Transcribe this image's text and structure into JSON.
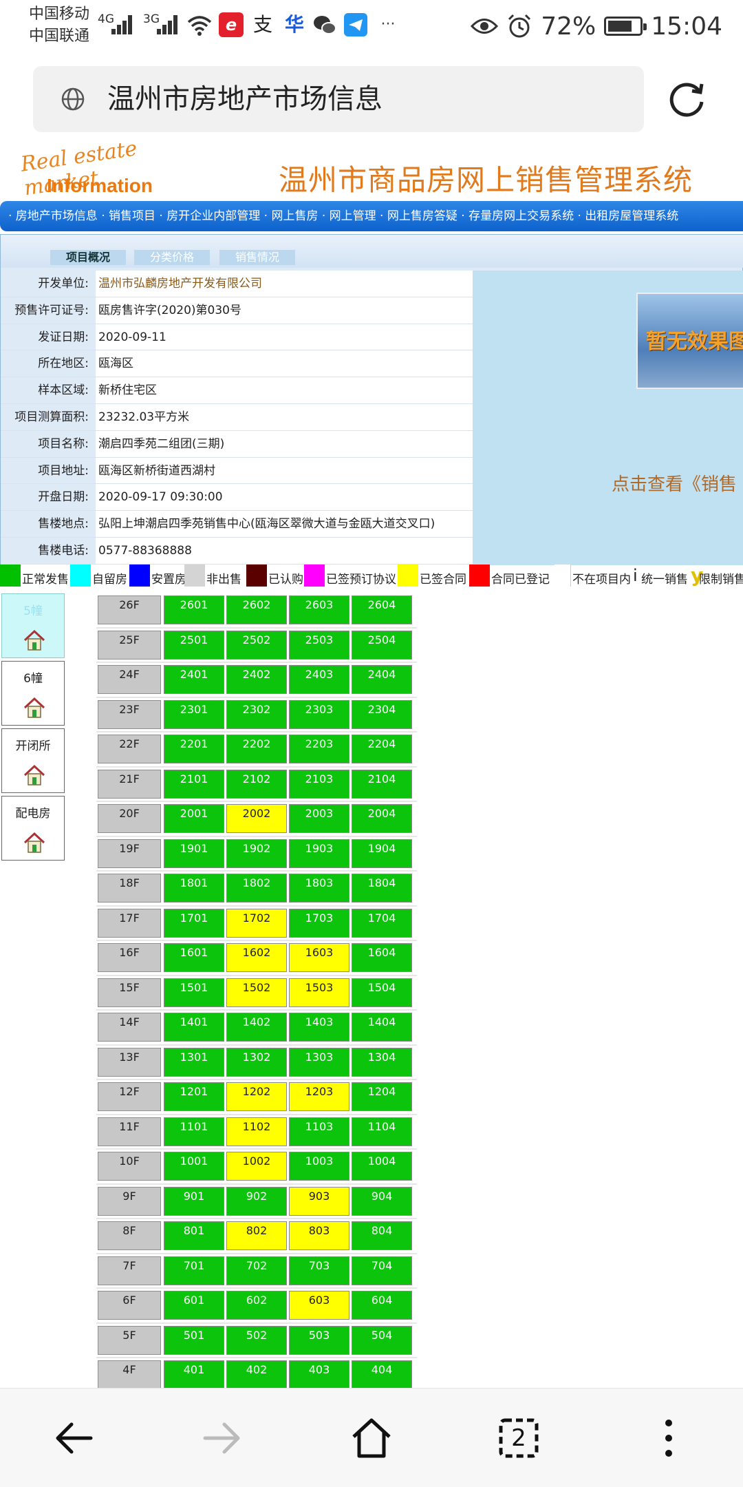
{
  "status": {
    "carrier1": "中国移动",
    "carrier2": "中国联通",
    "net1": "4G",
    "net2": "3G",
    "battery": "72%",
    "time": "15:04",
    "more": "···"
  },
  "address": {
    "title": "温州市房地产市场信息"
  },
  "header": {
    "logo_line1": "Real estate market",
    "logo_line2": "Information",
    "system_title": "温州市商品房网上销售管理系统",
    "nav": "· 房地产市场信息 · 销售项目 · 房开企业内部管理 · 网上售房 · 网上管理 · 网上售房答疑 · 存量房网上交易系统 · 出租房屋管理系统"
  },
  "tabs": [
    "项目概况",
    "分类价格",
    "销售情况"
  ],
  "info": [
    {
      "label": "开发单位:",
      "value": "温州市弘麟房地产开发有限公司"
    },
    {
      "label": "预售许可证号:",
      "value": "瓯房售许字(2020)第030号"
    },
    {
      "label": "发证日期:",
      "value": "2020-09-11"
    },
    {
      "label": "所在地区:",
      "value": "瓯海区"
    },
    {
      "label": "样本区域:",
      "value": "新桥住宅区"
    },
    {
      "label": "项目测算面积:",
      "value": "23232.03平方米"
    },
    {
      "label": "项目名称:",
      "value": "潮启四季苑二组团(三期)"
    },
    {
      "label": "项目地址:",
      "value": "瓯海区新桥街道西湖村"
    },
    {
      "label": "开盘日期:",
      "value": "2020-09-17 09:30:00"
    },
    {
      "label": "售楼地点:",
      "value": "弘阳上坤潮启四季苑销售中心(瓯海区翠微大道与金瓯大道交叉口)"
    },
    {
      "label": "售楼电话:",
      "value": "0577-88368888"
    }
  ],
  "promo": {
    "image_text": "暂无效果图",
    "link": "点击查看《销售"
  },
  "legend": [
    {
      "color": "#00c000",
      "label": "正常发售"
    },
    {
      "color": "#00ffff",
      "label": "自留房"
    },
    {
      "color": "#0000ff",
      "label": "安置房"
    },
    {
      "color": "#d4d4d4",
      "label": "非出售"
    },
    {
      "color": "#5a0000",
      "label": "已认购"
    },
    {
      "color": "#ff00ff",
      "label": "已签预订协议"
    },
    {
      "color": "#ffff00",
      "label": "已签合同"
    },
    {
      "color": "#ff0000",
      "label": "合同已登记"
    },
    {
      "color": "#ffffff",
      "label": "不在项目内"
    },
    {
      "color": "",
      "mark": "i",
      "label": "统一销售"
    },
    {
      "color": "",
      "mark": "y",
      "label": "限制销售"
    }
  ],
  "buildings": [
    {
      "name": "5幢",
      "selected": true
    },
    {
      "name": "6幢",
      "selected": false
    },
    {
      "name": "开闭所",
      "selected": false
    },
    {
      "name": "配电房",
      "selected": false
    }
  ],
  "floors": [
    {
      "floor": "26F",
      "units": [
        [
          "2601",
          "g"
        ],
        [
          "2602",
          "g"
        ],
        [
          "2603",
          "g"
        ],
        [
          "2604",
          "g"
        ]
      ]
    },
    {
      "floor": "25F",
      "units": [
        [
          "2501",
          "g"
        ],
        [
          "2502",
          "g"
        ],
        [
          "2503",
          "g"
        ],
        [
          "2504",
          "g"
        ]
      ]
    },
    {
      "floor": "24F",
      "units": [
        [
          "2401",
          "g"
        ],
        [
          "2402",
          "g"
        ],
        [
          "2403",
          "g"
        ],
        [
          "2404",
          "g"
        ]
      ]
    },
    {
      "floor": "23F",
      "units": [
        [
          "2301",
          "g"
        ],
        [
          "2302",
          "g"
        ],
        [
          "2303",
          "g"
        ],
        [
          "2304",
          "g"
        ]
      ]
    },
    {
      "floor": "22F",
      "units": [
        [
          "2201",
          "g"
        ],
        [
          "2202",
          "g"
        ],
        [
          "2203",
          "g"
        ],
        [
          "2204",
          "g"
        ]
      ]
    },
    {
      "floor": "21F",
      "units": [
        [
          "2101",
          "g"
        ],
        [
          "2102",
          "g"
        ],
        [
          "2103",
          "g"
        ],
        [
          "2104",
          "g"
        ]
      ]
    },
    {
      "floor": "20F",
      "units": [
        [
          "2001",
          "g"
        ],
        [
          "2002",
          "y"
        ],
        [
          "2003",
          "g"
        ],
        [
          "2004",
          "g"
        ]
      ]
    },
    {
      "floor": "19F",
      "units": [
        [
          "1901",
          "g"
        ],
        [
          "1902",
          "g"
        ],
        [
          "1903",
          "g"
        ],
        [
          "1904",
          "g"
        ]
      ]
    },
    {
      "floor": "18F",
      "units": [
        [
          "1801",
          "g"
        ],
        [
          "1802",
          "g"
        ],
        [
          "1803",
          "g"
        ],
        [
          "1804",
          "g"
        ]
      ]
    },
    {
      "floor": "17F",
      "units": [
        [
          "1701",
          "g"
        ],
        [
          "1702",
          "y"
        ],
        [
          "1703",
          "g"
        ],
        [
          "1704",
          "g"
        ]
      ]
    },
    {
      "floor": "16F",
      "units": [
        [
          "1601",
          "g"
        ],
        [
          "1602",
          "y"
        ],
        [
          "1603",
          "y"
        ],
        [
          "1604",
          "g"
        ]
      ]
    },
    {
      "floor": "15F",
      "units": [
        [
          "1501",
          "g"
        ],
        [
          "1502",
          "y"
        ],
        [
          "1503",
          "y"
        ],
        [
          "1504",
          "g"
        ]
      ]
    },
    {
      "floor": "14F",
      "units": [
        [
          "1401",
          "g"
        ],
        [
          "1402",
          "g"
        ],
        [
          "1403",
          "g"
        ],
        [
          "1404",
          "g"
        ]
      ]
    },
    {
      "floor": "13F",
      "units": [
        [
          "1301",
          "g"
        ],
        [
          "1302",
          "g"
        ],
        [
          "1303",
          "g"
        ],
        [
          "1304",
          "g"
        ]
      ]
    },
    {
      "floor": "12F",
      "units": [
        [
          "1201",
          "g"
        ],
        [
          "1202",
          "y"
        ],
        [
          "1203",
          "y"
        ],
        [
          "1204",
          "g"
        ]
      ]
    },
    {
      "floor": "11F",
      "units": [
        [
          "1101",
          "g"
        ],
        [
          "1102",
          "y"
        ],
        [
          "1103",
          "g"
        ],
        [
          "1104",
          "g"
        ]
      ]
    },
    {
      "floor": "10F",
      "units": [
        [
          "1001",
          "g"
        ],
        [
          "1002",
          "y"
        ],
        [
          "1003",
          "g"
        ],
        [
          "1004",
          "g"
        ]
      ]
    },
    {
      "floor": "9F",
      "units": [
        [
          "901",
          "g"
        ],
        [
          "902",
          "g"
        ],
        [
          "903",
          "y"
        ],
        [
          "904",
          "g"
        ]
      ]
    },
    {
      "floor": "8F",
      "units": [
        [
          "801",
          "g"
        ],
        [
          "802",
          "y"
        ],
        [
          "803",
          "y"
        ],
        [
          "804",
          "g"
        ]
      ]
    },
    {
      "floor": "7F",
      "units": [
        [
          "701",
          "g"
        ],
        [
          "702",
          "g"
        ],
        [
          "703",
          "g"
        ],
        [
          "704",
          "g"
        ]
      ]
    },
    {
      "floor": "6F",
      "units": [
        [
          "601",
          "g"
        ],
        [
          "602",
          "g"
        ],
        [
          "603",
          "y"
        ],
        [
          "604",
          "g"
        ]
      ]
    },
    {
      "floor": "5F",
      "units": [
        [
          "501",
          "g"
        ],
        [
          "502",
          "g"
        ],
        [
          "503",
          "g"
        ],
        [
          "504",
          "g"
        ]
      ]
    },
    {
      "floor": "4F",
      "units": [
        [
          "401",
          "g"
        ],
        [
          "402",
          "g"
        ],
        [
          "403",
          "g"
        ],
        [
          "404",
          "g"
        ]
      ]
    }
  ],
  "bottom_nav": {
    "tab_count": "2"
  }
}
